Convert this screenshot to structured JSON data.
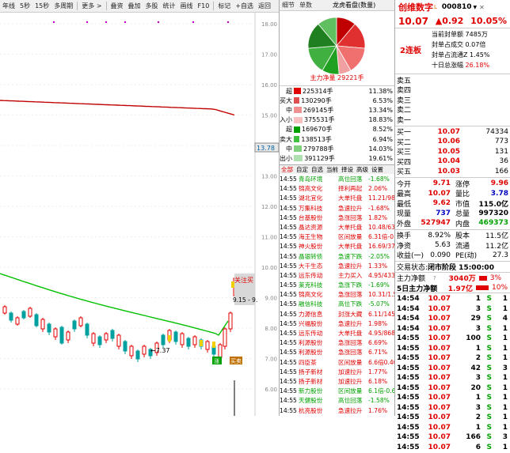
{
  "toolbar": [
    "年线",
    "5秒",
    "15秒",
    "多周期",
    "更多 >",
    "叠资",
    "叠加",
    "多股",
    "统计",
    "画线",
    "F10",
    "标记",
    "+自选",
    "返回"
  ],
  "chart": {
    "y_labels": [
      "18.00",
      "17.00",
      "16.00",
      "15.00",
      "14.00",
      "13.00",
      "12.00",
      "11.00",
      "10.00",
      "9.00",
      "8.00",
      "7.00",
      "6.00"
    ],
    "price_box": "13.78",
    "low_label": "7.37",
    "range_label": "9.15 - 9.",
    "follow_label": "关注买",
    "badge1": "涨",
    "badge2": "买卖",
    "colors": {
      "up": "#e00000",
      "down": "#00a0a0",
      "ma": "#00c000",
      "line": "#c00000"
    }
  },
  "mid": {
    "tabs": [
      "细节",
      "单数",
      "龙虎看盘(数量)"
    ],
    "pie_caption": "主力净量 29221手",
    "flow_in": [
      {
        "k": "超",
        "v": "225314手",
        "p": "11.38%",
        "c": "#e00000",
        "w": 50
      },
      {
        "k": "大",
        "v": "130290手",
        "p": "6.53%",
        "c": "#e05050",
        "w": 32
      },
      {
        "k": "中",
        "v": "269145手",
        "p": "13.34%",
        "c": "#f09090",
        "w": 58
      },
      {
        "k": "小",
        "v": "375531手",
        "p": "18.83%",
        "c": "#f8c0c0",
        "w": 70
      }
    ],
    "flow_out": [
      {
        "k": "超",
        "v": "169670手",
        "p": "8.52%",
        "c": "#00a000",
        "w": 40
      },
      {
        "k": "大",
        "v": "138513手",
        "p": "6.94%",
        "c": "#40c040",
        "w": 34
      },
      {
        "k": "中",
        "v": "279788手",
        "p": "14.03%",
        "c": "#80d080",
        "w": 60
      },
      {
        "k": "小",
        "v": "391129手",
        "p": "19.61%",
        "c": "#b0e0b0",
        "w": 72
      }
    ],
    "side_in": [
      "买",
      "入"
    ],
    "side_out": [
      "卖",
      "出"
    ],
    "news_tabs": [
      "全部",
      "自定",
      "自选",
      "当前",
      "择设",
      "高级",
      "设置"
    ],
    "news": [
      {
        "t": "14:55",
        "n": "青岛环境",
        "e": "高位回落",
        "d": "-1.68%",
        "c": "green"
      },
      {
        "t": "14:55",
        "n": "锦高文化",
        "e": "择利再起",
        "d": "2.06%",
        "c": "red"
      },
      {
        "t": "14:55",
        "n": "湖北宜化",
        "e": "大单托盘",
        "d": "11.21/9879",
        "c": "red"
      },
      {
        "t": "14:55",
        "n": "万集科技",
        "e": "急速拉升",
        "d": "-1.68%",
        "c": "red"
      },
      {
        "t": "14:55",
        "n": "台基股份",
        "e": "急涨回落",
        "d": "1.82%",
        "c": "red"
      },
      {
        "t": "14:55",
        "n": "晶达资源",
        "e": "大单托盘",
        "d": "10.48/6332",
        "c": "red"
      },
      {
        "t": "14:55",
        "n": "海王生物",
        "e": "区间放量",
        "d": "6.31倍-0.43%",
        "c": "red"
      },
      {
        "t": "14:55",
        "n": "神火股份",
        "e": "大单托盘",
        "d": "16.69/3763",
        "c": "red"
      },
      {
        "t": "14:55",
        "n": "晶银转债",
        "e": "急速下跌",
        "d": "-2.05%",
        "c": "green"
      },
      {
        "t": "14:55",
        "n": "大千生态",
        "e": "急速拉升",
        "d": "1.33%",
        "c": "red"
      },
      {
        "t": "14:55",
        "n": "远东传动",
        "e": "主力买入",
        "d": "4.95/4337",
        "c": "red"
      },
      {
        "t": "14:55",
        "n": "莱克科技",
        "e": "急涨下跌",
        "d": "-1.69%",
        "c": "green"
      },
      {
        "t": "14:55",
        "n": "锦高文化",
        "e": "急涨回落",
        "d": "10.31/1.52%",
        "c": "red"
      },
      {
        "t": "14:55",
        "n": "融信科技",
        "e": "高位下跌",
        "d": "-5.07%",
        "c": "green"
      },
      {
        "t": "14:55",
        "n": "力源信息",
        "e": "封涨大藏",
        "d": "6.11/145031",
        "c": "red"
      },
      {
        "t": "14:55",
        "n": "兴福股份",
        "e": "急速拉升",
        "d": "1.98%",
        "c": "red"
      },
      {
        "t": "14:55",
        "n": "远东传动",
        "e": "大单托盘",
        "d": "4.95/8685",
        "c": "red"
      },
      {
        "t": "14:55",
        "n": "利源股份",
        "e": "急涨回落",
        "d": "6.69%",
        "c": "red"
      },
      {
        "t": "14:55",
        "n": "利源股份",
        "e": "急涨回落",
        "d": "6.71%",
        "c": "red"
      },
      {
        "t": "14:55",
        "n": "四臣茶",
        "e": "区间放量",
        "d": "6.6倍0.40%",
        "c": "red"
      },
      {
        "t": "14:55",
        "n": "扬子新材",
        "e": "加速拉升",
        "d": "1.77%",
        "c": "red"
      },
      {
        "t": "14:55",
        "n": "扬子新材",
        "e": "加速拉升",
        "d": "6.18%",
        "c": "red"
      },
      {
        "t": "14:55",
        "n": "新力股份",
        "e": "区间放量",
        "d": "6.1倍-0.61%",
        "c": "green"
      },
      {
        "t": "14:55",
        "n": "天健股份",
        "e": "高位回落",
        "d": "-1.58%",
        "c": "green"
      },
      {
        "t": "14:55",
        "n": "杭亮股份",
        "e": "急速拉升",
        "d": "1.76%",
        "c": "red"
      },
      {
        "t": "14:55",
        "n": "优博讯",
        "e": "择利再起",
        "d": "1.55%",
        "c": "red"
      },
      {
        "t": "14:55",
        "n": "施贸股份",
        "e": "封涨大藏",
        "d": "42.59/4583",
        "c": "red"
      },
      {
        "t": "14:55",
        "n": "利源股份",
        "e": "择利再起",
        "d": "2.66%",
        "c": "red"
      },
      {
        "t": "14:55",
        "n": "亚太药业",
        "e": "封涨大藏",
        "d": "3.06/5006",
        "c": "red"
      },
      {
        "t": "14:55",
        "n": "青岛环境",
        "e": "早疾下跌",
        "d": "-2.06%",
        "c": "green"
      }
    ]
  },
  "right": {
    "name": "创维数字",
    "sub": "L",
    "code": "000810",
    "price": "10.07",
    "change": "▲0.92",
    "pct": "10.05%",
    "board": "2连板",
    "notes": [
      {
        "k": "当前封单额",
        "v": "7485万",
        "c": "#000"
      },
      {
        "k": "封单占成交",
        "v": "0.07倍",
        "c": "#000"
      },
      {
        "k": "封单占流通Z",
        "v": "1.45%",
        "c": "#000"
      },
      {
        "k": "十日总涨幅",
        "v": "26.18%",
        "c": "red"
      }
    ],
    "asks": [
      {
        "k": "卖五",
        "p": "",
        "v": ""
      },
      {
        "k": "卖四",
        "p": "",
        "v": ""
      },
      {
        "k": "卖三",
        "p": "",
        "v": ""
      },
      {
        "k": "卖二",
        "p": "",
        "v": ""
      },
      {
        "k": "卖一",
        "p": "",
        "v": ""
      }
    ],
    "bids": [
      {
        "k": "买一",
        "p": "10.07",
        "v": "74334"
      },
      {
        "k": "买二",
        "p": "10.06",
        "v": "773"
      },
      {
        "k": "买三",
        "p": "10.05",
        "v": "131"
      },
      {
        "k": "买四",
        "p": "10.04",
        "v": "36"
      },
      {
        "k": "买五",
        "p": "10.03",
        "v": "166"
      }
    ],
    "stats": [
      {
        "k1": "今开",
        "v1": "9.71",
        "c1": "red",
        "k2": "涨停",
        "v2": "9.96",
        "c2": "red"
      },
      {
        "k1": "最高",
        "v1": "10.07",
        "c1": "red",
        "k2": "量比",
        "v2": "3.78",
        "c2": "blue"
      },
      {
        "k1": "最低",
        "v1": "9.62",
        "c1": "red",
        "k2": "市值",
        "v2": "115.0亿",
        "c2": "black"
      },
      {
        "k1": "现量",
        "v1": "737",
        "c1": "blue",
        "k2": "总量",
        "v2": "997320",
        "c2": "black"
      },
      {
        "k1": "外盘",
        "v1": "527947",
        "c1": "red",
        "k2": "内盘",
        "v2": "469373",
        "c2": "green"
      }
    ],
    "fund": [
      {
        "k1": "换手",
        "v1": "8.92%",
        "k2": "股本",
        "v2": "11.5亿"
      },
      {
        "k1": "净资",
        "v1": "5.63",
        "k2": "流通",
        "v2": "11.2亿"
      },
      {
        "k1": "收益(一)",
        "v1": "0.090",
        "k2": "PE(动)",
        "v2": "27.3"
      }
    ],
    "trade_state_label": "交易状态:",
    "trade_state": "闭市阶段 15:00:00",
    "main_net": {
      "k": "主力净额",
      "v": "3040万",
      "p": "3%"
    },
    "five_day": {
      "k": "5日主力净额",
      "v": "1.97亿",
      "p": "10%"
    },
    "ticks": [
      {
        "t": "14:54",
        "p": "10.07",
        "v": "1",
        "s": "S",
        "n": "1"
      },
      {
        "t": "14:54",
        "p": "10.07",
        "v": "3",
        "s": "S",
        "n": "1"
      },
      {
        "t": "14:54",
        "p": "10.07",
        "v": "29",
        "s": "S",
        "n": "4"
      },
      {
        "t": "14:54",
        "p": "10.07",
        "v": "3",
        "s": "S",
        "n": "1"
      },
      {
        "t": "14:55",
        "p": "10.07",
        "v": "100",
        "s": "S",
        "n": "1"
      },
      {
        "t": "14:55",
        "p": "10.07",
        "v": "1",
        "s": "S",
        "n": "1"
      },
      {
        "t": "14:55",
        "p": "10.07",
        "v": "2",
        "s": "S",
        "n": "1"
      },
      {
        "t": "14:55",
        "p": "10.07",
        "v": "42",
        "s": "S",
        "n": "3"
      },
      {
        "t": "14:55",
        "p": "10.07",
        "v": "3",
        "s": "S",
        "n": "1"
      },
      {
        "t": "14:55",
        "p": "10.07",
        "v": "20",
        "s": "S",
        "n": "1"
      },
      {
        "t": "14:55",
        "p": "10.07",
        "v": "1",
        "s": "S",
        "n": "1"
      },
      {
        "t": "14:55",
        "p": "10.07",
        "v": "3",
        "s": "S",
        "n": "1"
      },
      {
        "t": "14:55",
        "p": "10.07",
        "v": "2",
        "s": "S",
        "n": "1"
      },
      {
        "t": "14:55",
        "p": "10.07",
        "v": "1",
        "s": "S",
        "n": "1"
      },
      {
        "t": "14:55",
        "p": "10.07",
        "v": "166",
        "s": "S",
        "n": "3"
      },
      {
        "t": "14:55",
        "p": "10.07",
        "v": "6",
        "s": "S",
        "n": "1"
      }
    ]
  }
}
